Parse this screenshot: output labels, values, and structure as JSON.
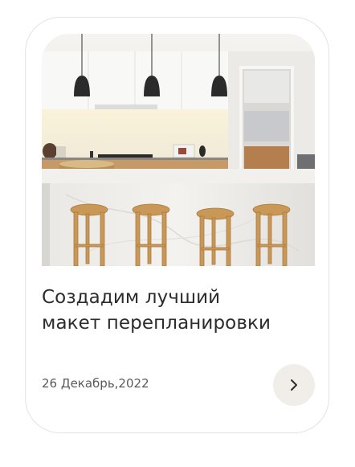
{
  "card": {
    "image_alt": "Kitchen interior with island and bar stools",
    "title_line1": "Создадим лучший",
    "title_line2": "макет перепланировки",
    "date": "26 Декабрь,2022",
    "next_icon": "chevron-right-icon"
  },
  "colors": {
    "card_border": "#e6e2dc",
    "button_bg": "#f1ede8",
    "title_text": "#2c2c2c",
    "date_text": "#5a5a5a"
  }
}
